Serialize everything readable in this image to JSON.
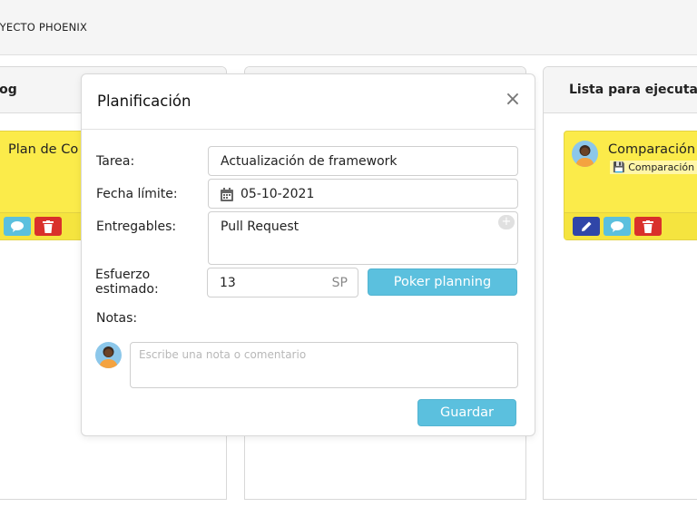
{
  "app": {
    "project_name": "OYECTO PHOENIX"
  },
  "columns": {
    "backlog": {
      "title": "klog"
    },
    "middle": {
      "title": ""
    },
    "ready": {
      "title": "Lista para ejecutar"
    }
  },
  "cards": {
    "backlog": {
      "title": "Plan de Co",
      "color": "#fbeb4a",
      "actions": [
        "comment-icon",
        "trash-icon"
      ]
    },
    "ready": {
      "title": "Comparación",
      "attachment": "💾 Comparación c",
      "color": "#fbeb4a",
      "actions": [
        "pencil-icon",
        "comment-icon",
        "trash-icon"
      ]
    }
  },
  "modal": {
    "title": "Planificación",
    "close_glyph": "×",
    "fields": {
      "task": {
        "label": "Tarea:",
        "value": "Actualización de framework"
      },
      "due": {
        "label": "Fecha límite:",
        "value": "05-10-2021"
      },
      "deliverables": {
        "label": "Entregables:",
        "value": "Pull Request",
        "add_glyph": "+"
      },
      "effort": {
        "label_line1": "Esfuerzo",
        "label_line2": "estimado:",
        "value": "13",
        "unit": "SP"
      },
      "notes": {
        "label": "Notas:",
        "placeholder": "Escribe una nota o comentario"
      }
    },
    "poker_button": "Poker planning",
    "save_button": "Guardar"
  },
  "colors": {
    "accent": "#5bc0de",
    "danger": "#d9302b",
    "edit": "#3046a8",
    "card": "#fbeb4a"
  }
}
